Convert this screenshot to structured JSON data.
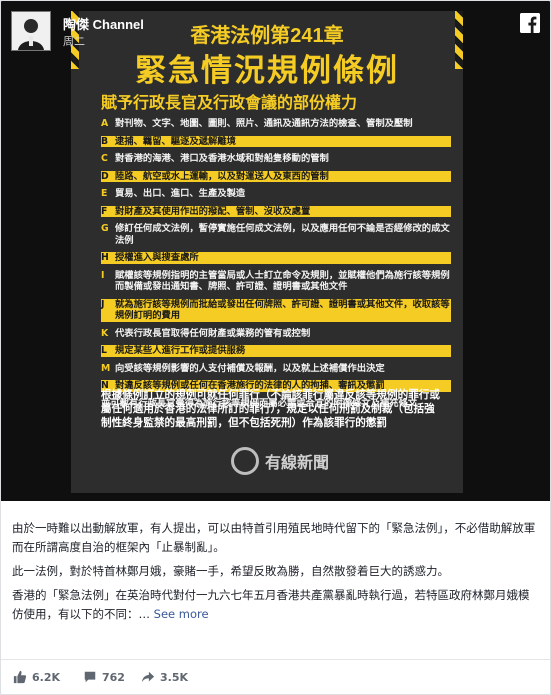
{
  "header": {
    "page_name": "陶傑 Channel",
    "post_time": "周二",
    "app_icon": "facebook-icon"
  },
  "poster": {
    "title_line1": "香港法例第241章",
    "title_line2": "緊急情況規例條例",
    "subtitle": "賦予行政長官及行政會議的部份權力",
    "items": [
      {
        "letter": "A",
        "text": "對刊物、文字、地圖、圖則、照片、通訊及通訊方法的檢查、管制及壓制",
        "highlight": false
      },
      {
        "letter": "B",
        "text": "逮捕、羈留、驅逐及遞解離境",
        "highlight": true
      },
      {
        "letter": "C",
        "text": "對香港的海港、港口及香港水域和對船隻移動的管制",
        "highlight": false
      },
      {
        "letter": "D",
        "text": "陸路、航空或水上運輸，以及對運送人及東西的管制",
        "highlight": true
      },
      {
        "letter": "E",
        "text": "貿易、出口、進口、生產及製造",
        "highlight": false
      },
      {
        "letter": "F",
        "text": "對財產及其使用作出的撥配、管制、沒收及處置",
        "highlight": true
      },
      {
        "letter": "G",
        "text": "修訂任何成文法例，暫停實施任何成文法例，以及應用任何不論是否經修改的成文法例",
        "highlight": false
      },
      {
        "letter": "H",
        "text": "授權進入與搜查處所",
        "highlight": true
      },
      {
        "letter": "I",
        "text": "賦權該等規例指明的主管當局或人士訂立命令及規則，並賦權他們為施行該等規例而製備或發出通知書、牌照、許可證、證明書或其他文件",
        "highlight": false
      },
      {
        "letter": "J",
        "text": "就為施行該等規例而批給或發出任何牌照、許可證、證明書或其他文件，收取該等規例訂明的費用",
        "highlight": true
      },
      {
        "letter": "K",
        "text": "代表行政長官取得任何財產或業務的管有或控制",
        "highlight": false
      },
      {
        "letter": "L",
        "text": "規定某些人進行工作或提供服務",
        "highlight": true
      },
      {
        "letter": "M",
        "text": "向受該等規例影響的人支付補償及報酬，以及就上述補償作出決定",
        "highlight": false
      },
      {
        "letter": "N",
        "text": "對違反該等規例或任何在香港施行的法律的人的拘捕、審訊及懲罰",
        "highlight": true
      }
    ],
    "extra_note": "並可載有行政長官覺得為施行該等規例而屬必需或合宜的附帶條文及補充條文",
    "penalty": "根據條例訂立的規例可就任何罪行（不論該罪行屬違反該等規例的罪行或屬任何適用於香港的法律所訂的罪行），規定以任何刑罰及制裁（包括強制性終身監禁的最高刑罰，但不包括死刑）作為該罪行的懲罰",
    "logo_text": "有線新聞"
  },
  "post": {
    "paragraphs": [
      "由於一時難以出動解放軍，有人提出，可以由特首引用殖民地時代留下的「緊急法例」，不必借助解放軍而在所謂高度自治的框架內「止暴制亂」。",
      "此一法例，對於特首林鄭月娥，豪賭一手，希望反敗為勝，自然散發着巨大的誘惑力。",
      "香港的「緊急法例」在英治時代對付一九六七年五月香港共產黨暴亂時執行過，若特區政府林鄭月娥模仿使用，有以下的不同："
    ],
    "ellipsis": "…",
    "see_more": "See more"
  },
  "footer": {
    "likes": "6.2K",
    "comments": "762",
    "shares": "3.5K"
  },
  "colors": {
    "accent_yellow": "#f5cc23",
    "facebook_link": "#385898"
  }
}
